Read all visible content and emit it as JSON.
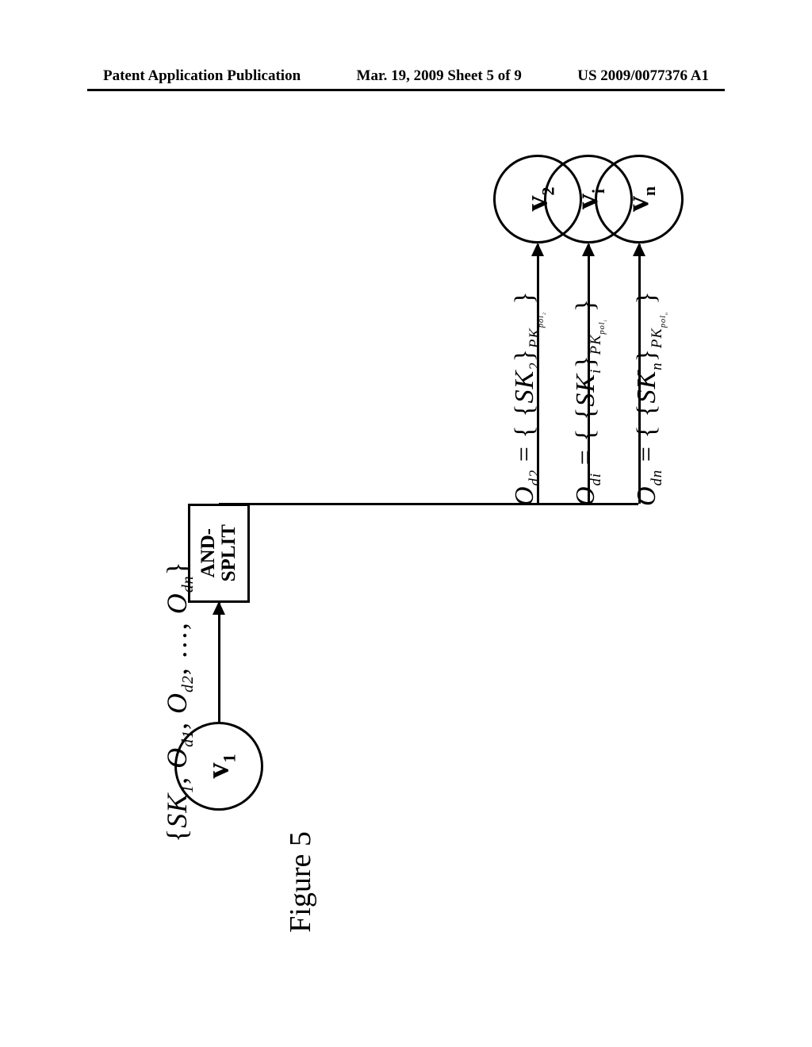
{
  "header": {
    "left": "Patent Application Publication",
    "center": "Mar. 19, 2009  Sheet 5 of 9",
    "right": "US 2009/0077376 A1"
  },
  "figure": {
    "caption": "Figure 5",
    "nodes": {
      "v1": "v₁",
      "v2": "v₂",
      "vi": "vᵢ",
      "vn": "vₙ"
    },
    "split_block": "AND-\nSPLIT",
    "v1_output": "{SK₁, O_d1, O_d2, …, O_dn}",
    "edge_labels": {
      "to_v2": "O_d2 = { {SK₂}_PK_pol₂ }",
      "to_vi": "O_di = { {SKᵢ}_PK_polᵢ }",
      "to_vn": "O_dn = { {SKₙ}_PK_polₙ }"
    }
  }
}
